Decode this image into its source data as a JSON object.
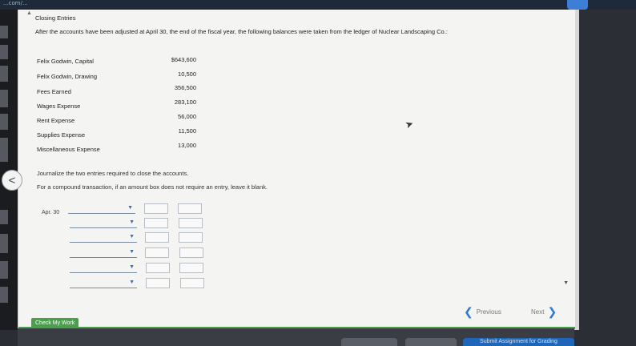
{
  "topbar": {
    "url_fragment": "...com/..."
  },
  "nav": {
    "back_symbol": "<"
  },
  "problem": {
    "title": "Closing Entries",
    "intro": "After the accounts have been adjusted at April 30, the end of the fiscal year, the following balances were taken from the ledger of Nuclear Landscaping Co.:",
    "balances": [
      {
        "account": "Felix Godwin, Capital",
        "amount": "$643,600"
      },
      {
        "account": "Felix Godwin, Drawing",
        "amount": "10,500"
      },
      {
        "account": "Fees Earned",
        "amount": "356,500"
      },
      {
        "account": "Wages Expense",
        "amount": "283,100"
      },
      {
        "account": "Rent Expense",
        "amount": "56,000"
      },
      {
        "account": "Supplies Expense",
        "amount": "11,500"
      },
      {
        "account": "Miscellaneous Expense",
        "amount": "13,000"
      }
    ],
    "instruction_1": "Journalize the two entries required to close the accounts.",
    "instruction_2": "For a compound transaction, if an amount box does not require an entry, leave it blank."
  },
  "journal": {
    "date": "Apr. 30",
    "dropdown_arrow": "▼",
    "rows": 6
  },
  "footer": {
    "previous_label": "Previous",
    "next_label": "Next",
    "check_label": "Check My Work",
    "submit_label": "Submit Assignment for Grading"
  },
  "colors": {
    "accent_blue": "#2f7bd1",
    "check_green": "#48a04a",
    "submit_blue": "#1f66b8"
  }
}
